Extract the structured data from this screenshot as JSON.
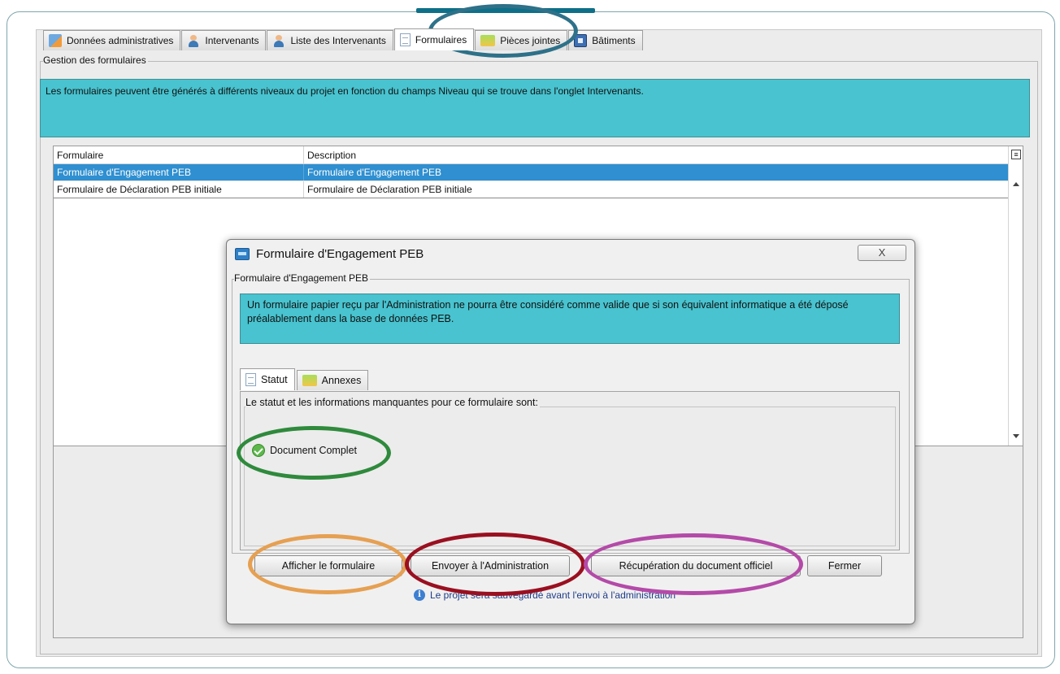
{
  "tabs": [
    {
      "label": "Données administratives",
      "icon": "edit-icon"
    },
    {
      "label": "Intervenants",
      "icon": "person-icon"
    },
    {
      "label": "Liste des Intervenants",
      "icon": "person-icon"
    },
    {
      "label": "Formulaires",
      "icon": "document-icon",
      "active": true
    },
    {
      "label": "Pièces jointes",
      "icon": "folder-icon"
    },
    {
      "label": "Bâtiments",
      "icon": "building-icon"
    }
  ],
  "section_title": "Gestion des formulaires",
  "info_banner": "Les formulaires peuvent être générés à différents niveaux du projet en fonction du champs Niveau qui se trouve dans l'onglet Intervenants.",
  "table": {
    "columns": [
      "Formulaire",
      "Description"
    ],
    "rows": [
      {
        "formulaire": "Formulaire d'Engagement PEB",
        "description": "Formulaire d'Engagement PEB",
        "selected": true
      },
      {
        "formulaire": "Formulaire de Déclaration PEB initiale",
        "description": "Formulaire de Déclaration PEB initiale",
        "selected": false
      }
    ]
  },
  "dialog": {
    "title": "Formulaire d'Engagement PEB",
    "close_label": "X",
    "group_title": "Formulaire d'Engagement PEB",
    "banner": "Un formulaire papier reçu par l'Administration ne pourra être considéré comme valide que si son équivalent informatique a été déposé préalablement dans la base de données PEB.",
    "tabs": [
      {
        "label": "Statut",
        "icon": "document-icon",
        "active": true
      },
      {
        "label": "Annexes",
        "icon": "folder-icon"
      }
    ],
    "status_heading": "Le statut et les informations manquantes pour ce formulaire sont:",
    "status": "Document Complet",
    "buttons": {
      "show": "Afficher le formulaire",
      "send": "Envoyer à l'Administration",
      "retrieve": "Récupération du document officiel",
      "close": "Fermer"
    },
    "notice": "Le projet sera sauvegardé avant l'envoi à l'administration"
  },
  "colors": {
    "banner": "#48c3cf",
    "selection": "#2f8fd0",
    "ring_tab": "#2e7189",
    "ring_status": "#2f8a3c",
    "ring_show": "#e6a052",
    "ring_send": "#9a1020",
    "ring_retrieve": "#b44aa8"
  }
}
